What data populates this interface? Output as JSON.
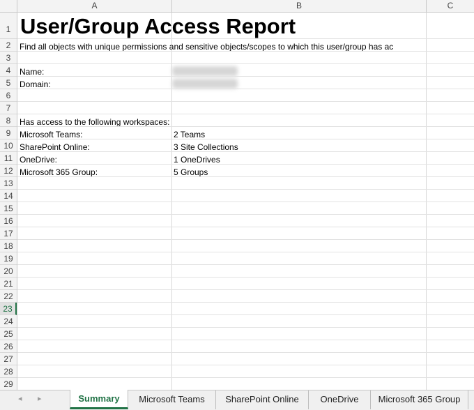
{
  "columns": [
    "A",
    "B",
    "C"
  ],
  "rows": [
    "1",
    "2",
    "3",
    "4",
    "5",
    "6",
    "7",
    "8",
    "9",
    "10",
    "11",
    "12",
    "13",
    "14",
    "15",
    "16",
    "17",
    "18",
    "19",
    "20",
    "21",
    "22",
    "23",
    "24",
    "25",
    "26",
    "27",
    "28",
    "29"
  ],
  "active_row": "23",
  "cells": {
    "title": "User/Group Access Report",
    "subtitle": "Find all objects with unique permissions and sensitive objects/scopes to which this user/group has ac",
    "name_label": "Name:",
    "domain_label": "Domain:",
    "workspaces_heading": "Has access to the following workspaces:",
    "workspaces": [
      {
        "label": "Microsoft Teams:",
        "value": "2 Teams"
      },
      {
        "label": "SharePoint Online:",
        "value": "3 Site Collections"
      },
      {
        "label": "OneDrive:",
        "value": "1 OneDrives"
      },
      {
        "label": "Microsoft 365 Group:",
        "value": "5 Groups"
      }
    ]
  },
  "tabs": [
    "Summary",
    "Microsoft Teams",
    "SharePoint Online",
    "OneDrive",
    "Microsoft 365 Group"
  ],
  "active_tab": "Summary",
  "nav": {
    "prev": "◂",
    "next": "▸"
  },
  "colors": {
    "accent": "#217346"
  }
}
